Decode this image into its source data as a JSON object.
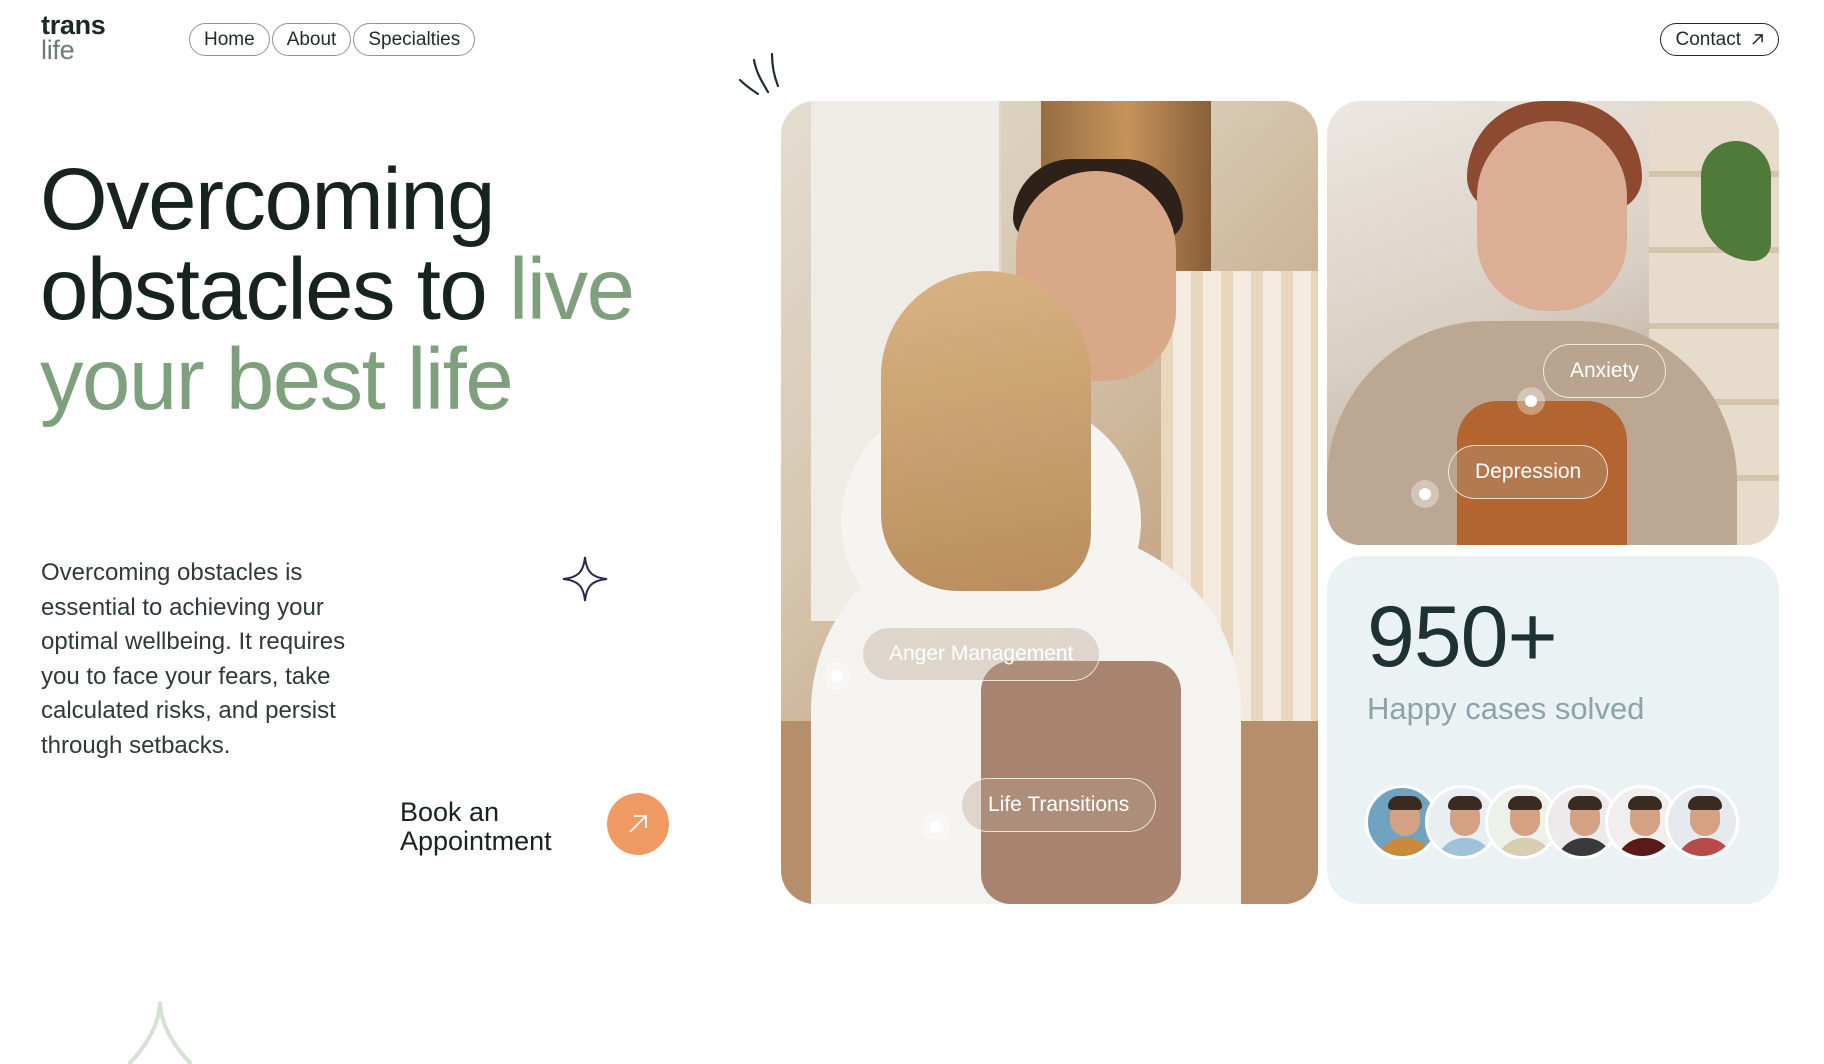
{
  "logo": {
    "line1": "trans",
    "line2": "life"
  },
  "nav": {
    "items": [
      "Home",
      "About",
      "Specialties"
    ]
  },
  "contact_label": "Contact",
  "hero": {
    "headline_part1": "Overcoming obstacles to ",
    "headline_accent": "live your best life",
    "description": "Overcoming obstacles is essential to achieving your optimal wellbeing. It requires you to face your fears, take calculated risks, and persist through setbacks.",
    "cta_line1": "Book an",
    "cta_line2": "Appointment"
  },
  "tags": {
    "anger": "Anger Management",
    "transitions": "Life Transitions",
    "anxiety": "Anxiety",
    "depression": "Depression"
  },
  "stats": {
    "number": "950+",
    "label": "Happy cases  solved"
  },
  "colors": {
    "accent_green": "#7fa07d",
    "cta_orange": "#ef9a62",
    "stats_bg": "#eaf2f4"
  },
  "avatars": [
    {
      "bg": "#6fa3c0",
      "shirt": "#c98a3a"
    },
    {
      "bg": "#e9eef2",
      "shirt": "#9fc2d8"
    },
    {
      "bg": "#eef0ea",
      "shirt": "#d6cdb2"
    },
    {
      "bg": "#eceaea",
      "shirt": "#3a3a3a"
    },
    {
      "bg": "#f1efed",
      "shirt": "#5a1a1a"
    },
    {
      "bg": "#e6eaef",
      "shirt": "#b84a4a"
    }
  ]
}
